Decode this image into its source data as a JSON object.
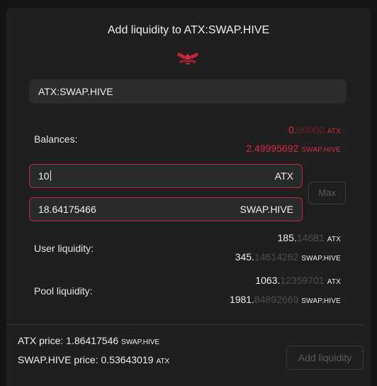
{
  "header": {
    "title": "Add liquidity to ATX:SWAP.HIVE",
    "logo_icon": "hive-bee-icon",
    "accent_color": "#d62a40"
  },
  "pair_select": {
    "value": "ATX:SWAP.HIVE"
  },
  "balances": {
    "label": "Balances:",
    "atx": {
      "main": "0.",
      "dim": "00000",
      "unit": "ATX"
    },
    "hive": {
      "main": "2.49995692",
      "dim": "",
      "unit": "SWAP.HIVE"
    }
  },
  "inputs": {
    "atx": {
      "value": "10",
      "currency": "ATX"
    },
    "hive": {
      "value": "18.64175466",
      "currency": "SWAP.HIVE"
    }
  },
  "max_button": {
    "label": "Max"
  },
  "user_liquidity": {
    "label": "User liquidity:",
    "atx": {
      "main": "185.",
      "dim": "14681",
      "unit": "ATX"
    },
    "hive": {
      "main": "345.",
      "dim": "14614262",
      "unit": "SWAP.HIVE"
    }
  },
  "pool_liquidity": {
    "label": "Pool liquidity:",
    "atx": {
      "main": "1063.",
      "dim": "12359701",
      "unit": "ATX"
    },
    "hive": {
      "main": "1981.",
      "dim": "84892669",
      "unit": "SWAP.HIVE"
    }
  },
  "prices": {
    "atx": {
      "label": "ATX price:",
      "value": "1.86417546",
      "unit": "SWAP.HIVE"
    },
    "hive": {
      "label": "SWAP.HIVE price:",
      "value": "0.53643019",
      "unit": "ATX"
    }
  },
  "add_button": {
    "label": "Add liquidity"
  }
}
